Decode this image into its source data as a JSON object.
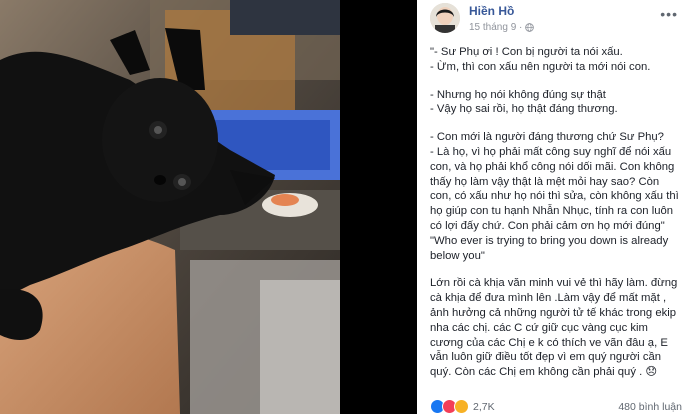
{
  "post": {
    "author": "Hiền Hồ",
    "date": "15 tháng 9 ·",
    "privacy_icon": "globe-icon",
    "more_icon": "more-options-icon",
    "paragraphs": [
      "\"- Sư Phụ ơi ! Con bị người ta nói xấu.\n- Ừm, thì con xấu nên người ta mới nói con.",
      "- Nhưng họ nói không đúng sự thật\n- Vậy họ sai rồi, họ thật đáng thương.",
      "- Con mới là người đáng thương chứ Sư Phụ?\n- Là họ, vì họ phải mất công suy nghĩ để nói xấu con, và họ phải khổ công nói dối mãi. Con không thấy họ làm vậy thật là mệt mỏi hay sao? Còn con, có xấu như họ nói thì sửa, còn không xấu thì họ giúp con tu hạnh Nhẫn Nhục, tính ra con luôn có lợi đấy chứ. Con phải cảm ơn họ mới đúng\"\n\"Who ever is trying to bring you down is already below you\"",
      "Lớn rồi cà khịa văn minh vui vẻ thì hãy làm. đừng cà khịa để đưa mình lên .Làm vậy để mất mặt , ảnh hưởng cả những người tử tế khác trong ekip nha các chị. các C cứ giữ cục vàng cục kim cương của các Chị e k có thích ve vãn đâu ạ, E vẫn luôn giữ điều tốt đẹp vì em quý người cần quý. Còn các Chị em không cần phải quý . 😞"
    ]
  },
  "reactions": {
    "icons": [
      "like-icon",
      "love-icon",
      "sad-icon"
    ],
    "colors": {
      "like": "#1877f2",
      "love": "#f33e58",
      "sad": "#f7b125"
    },
    "count": "2,7K",
    "comments": "480 bình luận"
  },
  "photo": {
    "subject_icon": "black-kitten-photo"
  }
}
